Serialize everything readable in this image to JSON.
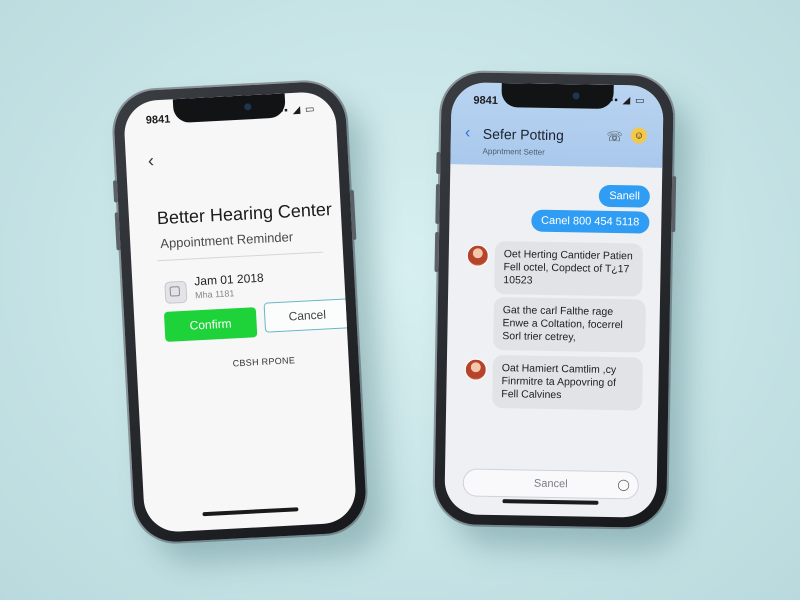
{
  "left_phone": {
    "status": {
      "time": "9841",
      "icons": "▪▪ ◢ ▭"
    },
    "back_glyph": "‹",
    "clinic_name": "Better Hearing Center",
    "subtitle": "Appointment Reminder",
    "appointment": {
      "date": "Jam 01 2018",
      "detail": "Mha 1181"
    },
    "confirm_label": "Confirm",
    "cancel_label": "Cancel",
    "footer_link": "CBSH RPONE",
    "colors": {
      "confirm": "#1ed33a",
      "cancel_border": "#6ab7c4"
    }
  },
  "right_phone": {
    "status": {
      "time": "9841",
      "icons": "▪▪ ◢ ▭"
    },
    "header": {
      "back_glyph": "‹",
      "name": "Sefer Potting",
      "subtitle": "Appntment Setter",
      "icons": [
        "phone-icon",
        "emoji-icon"
      ]
    },
    "outgoing": [
      {
        "text": "Sanell"
      },
      {
        "text": "Canel 800 454 5118"
      }
    ],
    "incoming": [
      {
        "text": "Oet Herting Cantider Patien Fell octel, Copdect of T¿17 10523"
      },
      {
        "text": "Gat the carl Falthe rage Enwe a Coltation, focerrel Sorl trier cetrey,"
      },
      {
        "text": "Oat Hamiert Camtlim ,cy Finrmitre ta Appovring of Fell Calvines"
      }
    ],
    "input_placeholder": "Sancel",
    "colors": {
      "header": "#b9d4f1",
      "outgoing": "#2f9df3",
      "incoming": "#e2e3e7"
    }
  }
}
